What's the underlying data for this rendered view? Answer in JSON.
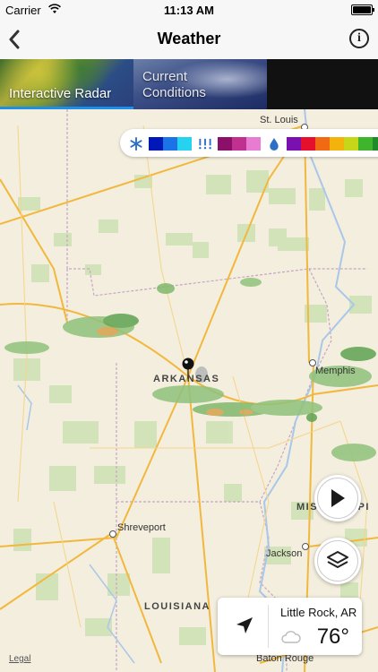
{
  "status_bar": {
    "carrier": "Carrier",
    "time": "11:13 AM"
  },
  "nav": {
    "title": "Weather",
    "back_icon": "chevron-left-icon",
    "info_icon": "info-icon",
    "info_glyph": "i"
  },
  "tabs": [
    {
      "label": "Interactive Radar",
      "selected": true
    },
    {
      "label": "Current\nConditions",
      "selected": false
    }
  ],
  "legend": {
    "snow_icon": "snowflake-icon",
    "snow_colors": [
      "#0018b8",
      "#1b73e8",
      "#25d3f0"
    ],
    "mix_icon": "sleet-icon",
    "mix_colors": [
      "#8c0f6a",
      "#c0308f",
      "#e87bd2"
    ],
    "rain_icon": "raindrop-icon",
    "rain_colors": [
      "#7a10b0",
      "#e4102e",
      "#f06a14",
      "#f4b20c",
      "#c6d618",
      "#3fb52d",
      "#1f8a2a"
    ]
  },
  "map": {
    "cities": [
      {
        "name": "St. Louis"
      },
      {
        "name": "Memphis"
      },
      {
        "name": "Shreveport"
      },
      {
        "name": "Jackson"
      },
      {
        "name": "Baton Rouge"
      }
    ],
    "states": [
      {
        "name": "ARKANSAS"
      },
      {
        "name": "MISSISSIPPI"
      },
      {
        "name": "LOUISIANA"
      }
    ]
  },
  "controls": {
    "play_icon": "play-icon",
    "layers_icon": "layers-icon"
  },
  "weather_card": {
    "location": "Little Rock, AR",
    "temperature": "76°",
    "location_icon": "location-arrow-icon",
    "condition_icon": "cloud-icon"
  },
  "legal_text": "Legal"
}
